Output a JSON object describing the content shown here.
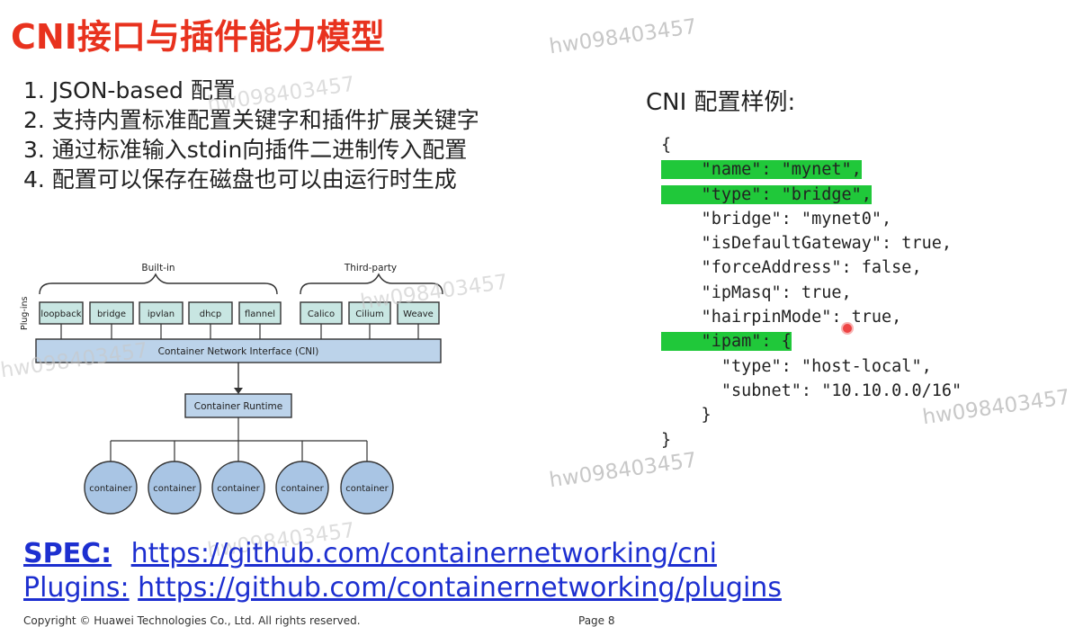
{
  "title": "CNI接口与插件能力模型",
  "watermark": "hw098403457",
  "points": [
    "1. JSON-based 配置",
    "2. 支持内置标准配置关键字和插件扩展关键字",
    "3. 通过标准输入stdin向插件二进制传入配置",
    "4. 配置可以保存在磁盘也可以由运行时生成"
  ],
  "sample_title": "CNI 配置样例:",
  "code_lines": [
    "{",
    "    \"name\": \"mynet\",",
    "    \"type\": \"bridge\",",
    "    \"bridge\": \"mynet0\",",
    "    \"isDefaultGateway\": true,",
    "    \"forceAddress\": false,",
    "    \"ipMasq\": true,",
    "    \"hairpinMode\": true,",
    "    \"ipam\": {",
    "      \"type\": \"host-local\",",
    "      \"subnet\": \"10.10.0.0/16\"",
    "    }",
    "}"
  ],
  "diagram": {
    "built_in_label": "Built-in",
    "third_party_label": "Third-party",
    "plugins_label": "Plug-ins",
    "built_in": [
      "loopback",
      "bridge",
      "ipvlan",
      "dhcp",
      "flannel"
    ],
    "third_party": [
      "Calico",
      "Cilium",
      "Weave"
    ],
    "cni_bar": "Container Network Interface (CNI)",
    "runtime": "Container Runtime",
    "containers": [
      "container",
      "container",
      "container",
      "container",
      "container"
    ],
    "colors": {
      "box_fill": "#c8e6e2",
      "bar_fill": "#bcd3ea",
      "circle_fill": "#a9c5e4",
      "stroke": "#333333"
    }
  },
  "links": {
    "spec_label": "SPEC:",
    "spec_url": "https://github.com/containernetworking/cni",
    "plugins_label": "Plugins:",
    "plugins_url": "https://github.com/containernetworking/plugins"
  },
  "footer": {
    "copyright": "Copyright © Huawei Technologies Co., Ltd. All rights reserved.",
    "page": "Page 8"
  },
  "colors": {
    "title": "#e8321e",
    "link": "#1d2fd0",
    "highlight": "#20c83a"
  }
}
